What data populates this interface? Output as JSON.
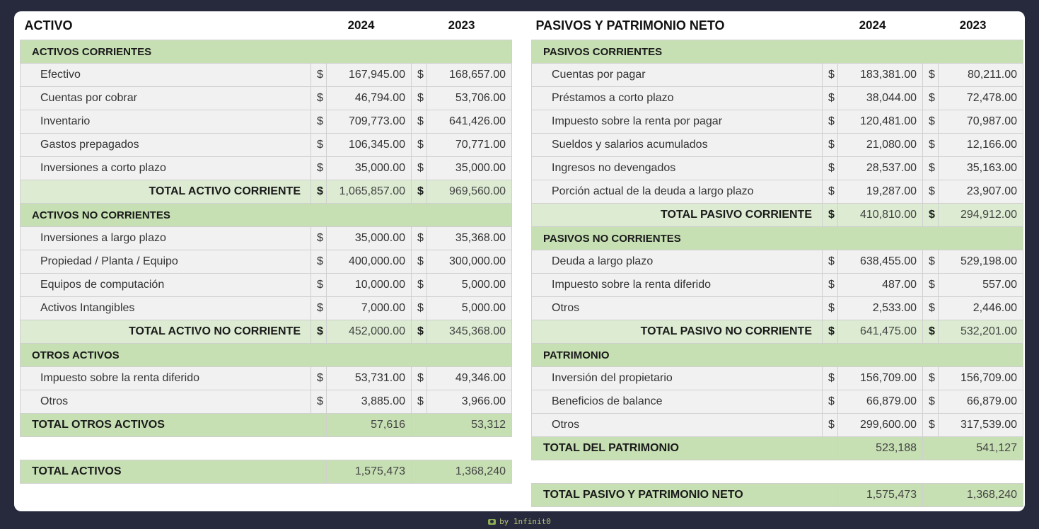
{
  "left": {
    "title": "ACTIVO",
    "year1": "2024",
    "year2": "2023",
    "currency": "$",
    "sections": {
      "current": {
        "label": "ACTIVOS CORRIENTES",
        "rows": [
          {
            "label": "Efectivo",
            "v2024": "167,945.00",
            "v2023": "168,657.00"
          },
          {
            "label": "Cuentas por cobrar",
            "v2024": "46,794.00",
            "v2023": "53,706.00"
          },
          {
            "label": "Inventario",
            "v2024": "709,773.00",
            "v2023": "641,426.00"
          },
          {
            "label": "Gastos prepagados",
            "v2024": "106,345.00",
            "v2023": "70,771.00"
          },
          {
            "label": "Inversiones a corto plazo",
            "v2024": "35,000.00",
            "v2023": "35,000.00"
          }
        ],
        "total": {
          "label": "TOTAL ACTIVO CORRIENTE",
          "v2024": "1,065,857.00",
          "v2023": "969,560.00"
        }
      },
      "noncurrent": {
        "label": "ACTIVOS NO CORRIENTES",
        "rows": [
          {
            "label": "Inversiones a largo plazo",
            "v2024": "35,000.00",
            "v2023": "35,368.00"
          },
          {
            "label": "Propiedad / Planta / Equipo",
            "v2024": "400,000.00",
            "v2023": "300,000.00"
          },
          {
            "label": "Equipos de computación",
            "v2024": "10,000.00",
            "v2023": "5,000.00"
          },
          {
            "label": "Activos Intangibles",
            "v2024": "7,000.00",
            "v2023": "5,000.00"
          }
        ],
        "total": {
          "label": "TOTAL ACTIVO NO CORRIENTE",
          "v2024": "452,000.00",
          "v2023": "345,368.00"
        }
      },
      "other": {
        "label": "OTROS ACTIVOS",
        "rows": [
          {
            "label": "Impuesto sobre la renta diferido",
            "v2024": "53,731.00",
            "v2023": "49,346.00"
          },
          {
            "label": "Otros",
            "v2024": "3,885.00",
            "v2023": "3,966.00"
          }
        ],
        "total": {
          "label": "TOTAL OTROS ACTIVOS",
          "v2024": "57,616",
          "v2023": "53,312"
        }
      }
    },
    "grand_total": {
      "label": "TOTAL ACTIVOS",
      "v2024": "1,575,473",
      "v2023": "1,368,240"
    }
  },
  "right": {
    "title": "PASIVOS Y PATRIMONIO NETO",
    "year1": "2024",
    "year2": "2023",
    "currency": "$",
    "sections": {
      "current": {
        "label": "PASIVOS CORRIENTES",
        "rows": [
          {
            "label": "Cuentas por pagar",
            "v2024": "183,381.00",
            "v2023": "80,211.00"
          },
          {
            "label": "Préstamos a corto plazo",
            "v2024": "38,044.00",
            "v2023": "72,478.00"
          },
          {
            "label": "Impuesto sobre la renta por pagar",
            "v2024": "120,481.00",
            "v2023": "70,987.00"
          },
          {
            "label": "Sueldos y salarios acumulados",
            "v2024": "21,080.00",
            "v2023": "12,166.00"
          },
          {
            "label": "Ingresos no devengados",
            "v2024": "28,537.00",
            "v2023": "35,163.00"
          },
          {
            "label": "Porción actual de la deuda a largo plazo",
            "v2024": "19,287.00",
            "v2023": "23,907.00"
          }
        ],
        "total": {
          "label": "TOTAL PASIVO CORRIENTE",
          "v2024": "410,810.00",
          "v2023": "294,912.00"
        }
      },
      "noncurrent": {
        "label": "PASIVOS NO CORRIENTES",
        "rows": [
          {
            "label": "Deuda a largo plazo",
            "v2024": "638,455.00",
            "v2023": "529,198.00"
          },
          {
            "label": "Impuesto sobre la renta diferido",
            "v2024": "487.00",
            "v2023": "557.00"
          },
          {
            "label": "Otros",
            "v2024": "2,533.00",
            "v2023": "2,446.00"
          }
        ],
        "total": {
          "label": "TOTAL PASIVO NO CORRIENTE",
          "v2024": "641,475.00",
          "v2023": "532,201.00"
        }
      },
      "equity": {
        "label": "PATRIMONIO",
        "rows": [
          {
            "label": "Inversión del propietario",
            "v2024": "156,709.00",
            "v2023": "156,709.00"
          },
          {
            "label": "Beneficios de balance",
            "v2024": "66,879.00",
            "v2023": "66,879.00"
          },
          {
            "label": "Otros",
            "v2024": "299,600.00",
            "v2023": "317,539.00"
          }
        ],
        "total": {
          "label": "TOTAL DEL PATRIMONIO",
          "v2024": "523,188",
          "v2023": "541,127"
        }
      }
    },
    "grand_total": {
      "label": "TOTAL PASIVO Y PATRIMONIO NETO",
      "v2024": "1,575,473",
      "v2023": "1,368,240"
    }
  },
  "footer": {
    "text": "by 1nfinit0",
    "icon": "camera-icon"
  }
}
